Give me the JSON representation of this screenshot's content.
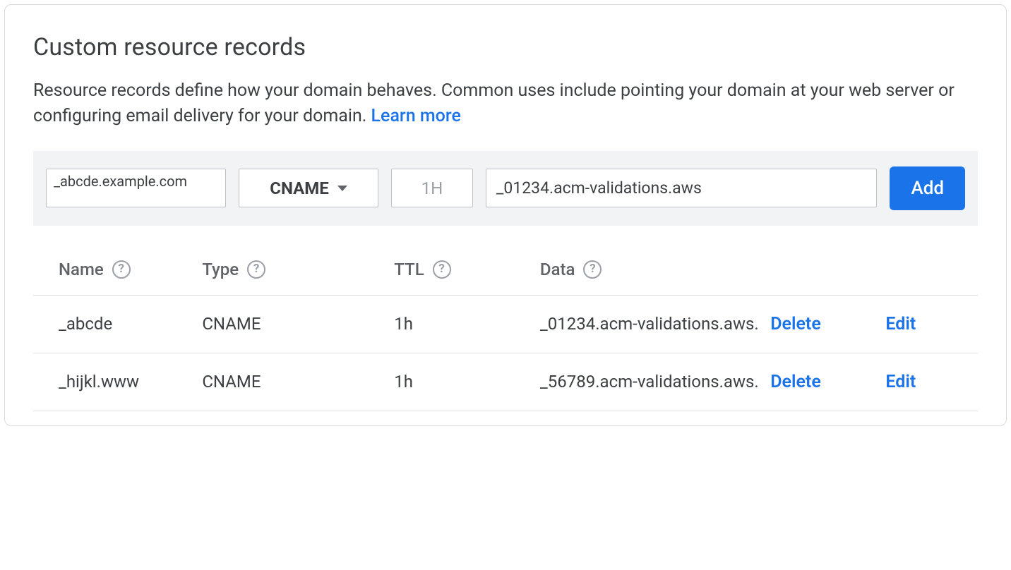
{
  "header": {
    "title": "Custom resource records",
    "description": "Resource records define how your domain behaves. Common uses include pointing your domain at your web server or configuring email delivery for your domain. ",
    "learn_more": "Learn more"
  },
  "form": {
    "name_value": "_abcde.example.com",
    "type_value": "CNAME",
    "ttl_placeholder": "1H",
    "data_value": "_01234.acm-validations.aws",
    "add_label": "Add"
  },
  "columns": {
    "name": "Name",
    "type": "Type",
    "ttl": "TTL",
    "data": "Data"
  },
  "actions": {
    "delete": "Delete",
    "edit": "Edit"
  },
  "records": [
    {
      "name": "_abcde",
      "type": "CNAME",
      "ttl": "1h",
      "data": "_01234.acm-validations.aws."
    },
    {
      "name": "_hijkl.www",
      "type": "CNAME",
      "ttl": "1h",
      "data": "_56789.acm-validations.aws."
    }
  ]
}
